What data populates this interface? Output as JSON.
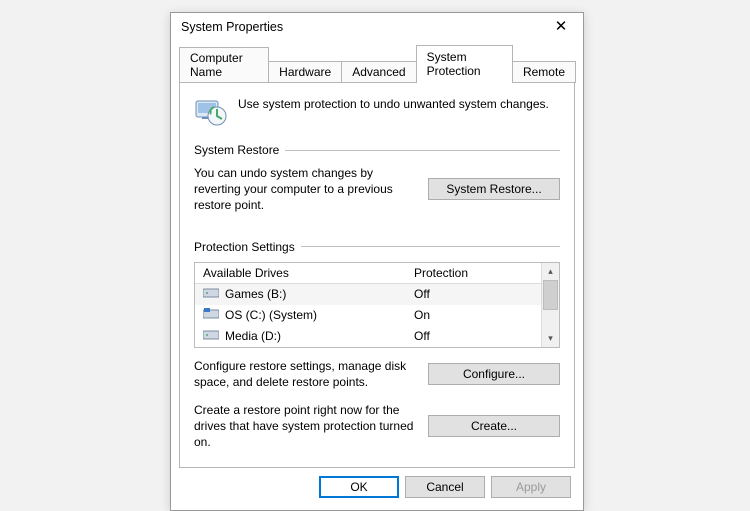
{
  "window": {
    "title": "System Properties"
  },
  "tabs": [
    {
      "label": "Computer Name"
    },
    {
      "label": "Hardware"
    },
    {
      "label": "Advanced"
    },
    {
      "label": "System Protection"
    },
    {
      "label": "Remote"
    }
  ],
  "intro_text": "Use system protection to undo unwanted system changes.",
  "groups": {
    "restore": {
      "heading": "System Restore",
      "desc": "You can undo system changes by reverting your computer to a previous restore point.",
      "button": "System Restore..."
    },
    "protection": {
      "heading": "Protection Settings",
      "col_drive": "Available Drives",
      "col_protection": "Protection",
      "drives": [
        {
          "name": "Games (B:)",
          "protection": "Off"
        },
        {
          "name": "OS (C:) (System)",
          "protection": "On"
        },
        {
          "name": "Media (D:)",
          "protection": "Off"
        }
      ],
      "configure_desc": "Configure restore settings, manage disk space, and delete restore points.",
      "configure_button": "Configure...",
      "create_desc": "Create a restore point right now for the drives that have system protection turned on.",
      "create_button": "Create..."
    }
  },
  "footer": {
    "ok": "OK",
    "cancel": "Cancel",
    "apply": "Apply"
  }
}
